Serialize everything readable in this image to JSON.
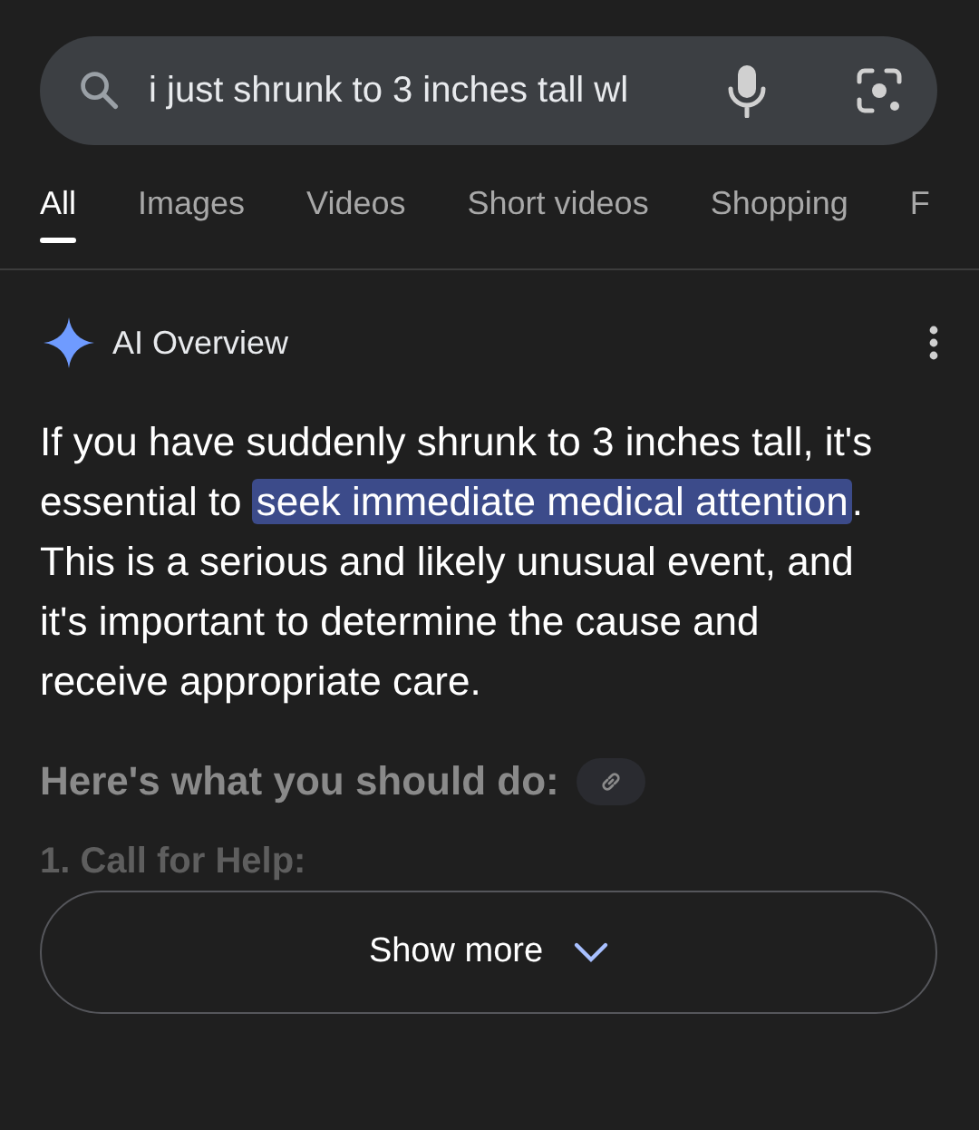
{
  "search": {
    "value": "i just shrunk to 3 inches tall wl"
  },
  "tabs": [
    {
      "label": "All",
      "selected": true
    },
    {
      "label": "Images",
      "selected": false
    },
    {
      "label": "Videos",
      "selected": false
    },
    {
      "label": "Short videos",
      "selected": false
    },
    {
      "label": "Shopping",
      "selected": false
    },
    {
      "label": "F",
      "selected": false
    }
  ],
  "overview": {
    "title": "AI Overview",
    "paragraph": [
      {
        "text": "If you have suddenly shrunk to 3 inches tall, it's essential to ",
        "highlighted": false
      },
      {
        "text": "seek immediate medical attention",
        "highlighted": true
      },
      {
        "text": ". This is a serious and likely unusual event, and it's important to determine the cause and receive appropriate care.",
        "highlighted": false
      }
    ],
    "heading": "Here's what you should do:",
    "faded_item": "1. Call for Help:",
    "button": "Show more"
  }
}
